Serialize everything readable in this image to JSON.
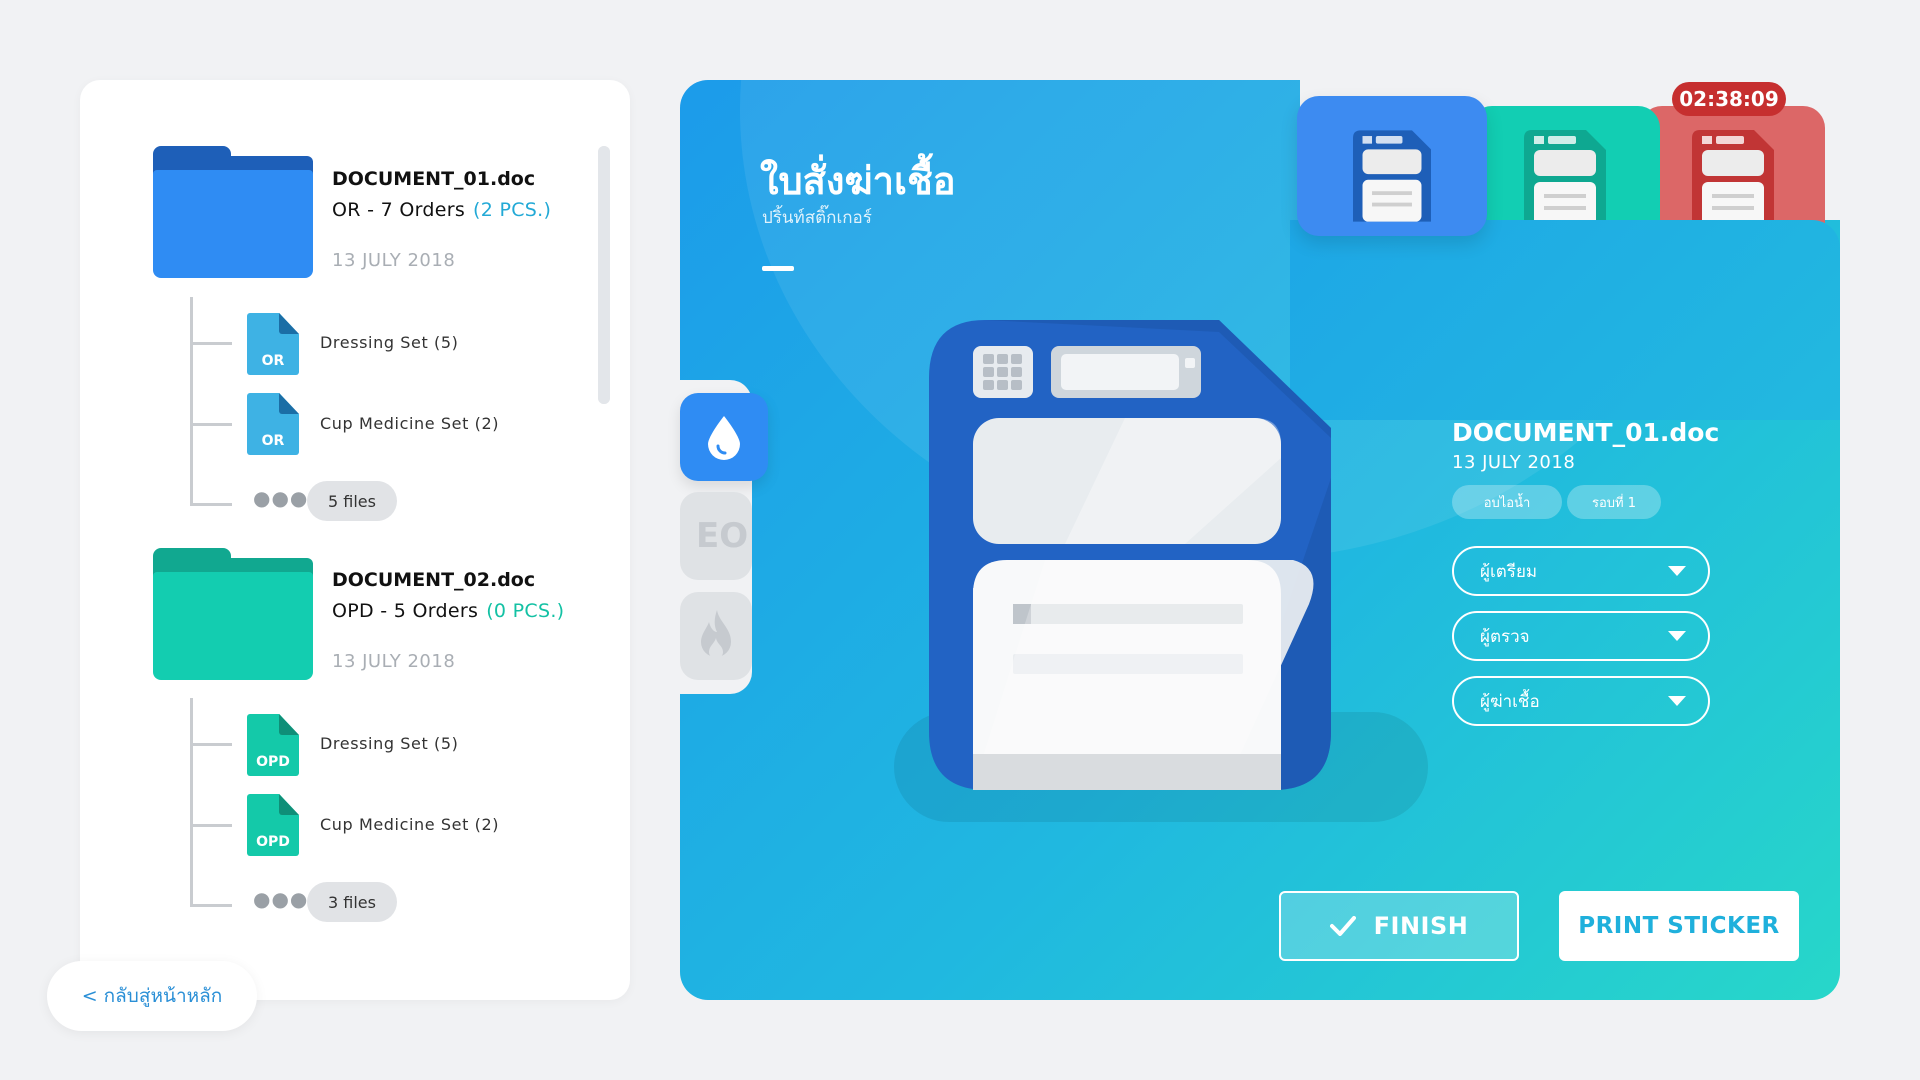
{
  "sidebar": {
    "documents": [
      {
        "name": "DOCUMENT_01.doc",
        "orders": "OR - 7 Orders",
        "pcs": "(2 PCS.)",
        "date": "13 JULY 2018",
        "color": "#2f8cf3",
        "files": [
          {
            "type": "OR",
            "name": "Dressing Set (5)"
          },
          {
            "type": "OR",
            "name": "Cup Medicine Set (2)"
          }
        ],
        "more_count": "5 files"
      },
      {
        "name": "DOCUMENT_02.doc",
        "orders": "OPD - 5 Orders",
        "pcs": "(0 PCS.)",
        "date": "13 JULY 2018",
        "color": "#13cdb0",
        "files": [
          {
            "type": "OPD",
            "name": "Dressing Set (5)"
          },
          {
            "type": "OPD",
            "name": "Cup Medicine Set (2)"
          }
        ],
        "more_count": "3 files"
      }
    ],
    "back_label": "< กลับสู่หน้าหลัก"
  },
  "main": {
    "title": "ใบสั่งฆ่าเชื้อ",
    "subtitle": "ปริ้นท์สติ๊กเกอร์",
    "side_tabs": [
      {
        "icon": "water-drop-icon",
        "active": true
      },
      {
        "icon": "eo-icon",
        "label": "EO",
        "active": false
      },
      {
        "icon": "flame-icon",
        "active": false
      }
    ],
    "top_tabs": [
      {
        "icon": "floppy-icon",
        "color": "#3d8bf1"
      },
      {
        "icon": "floppy-icon",
        "color": "#12ceb3"
      },
      {
        "icon": "floppy-icon",
        "color": "#dc6767"
      }
    ],
    "timer": "02:38:09"
  },
  "info": {
    "doc_name": "DOCUMENT_01.doc",
    "date": "13 JULY 2018",
    "tags": [
      "อบไอน้ำ",
      "รอบที่ 1"
    ],
    "dropdowns": [
      {
        "placeholder": "ผู้เตรียม"
      },
      {
        "placeholder": "ผู้ตรวจ"
      },
      {
        "placeholder": "ผู้ฆ่าเชื้อ"
      }
    ]
  },
  "actions": {
    "finish_label": "FINISH",
    "print_label": "PRINT STICKER"
  }
}
